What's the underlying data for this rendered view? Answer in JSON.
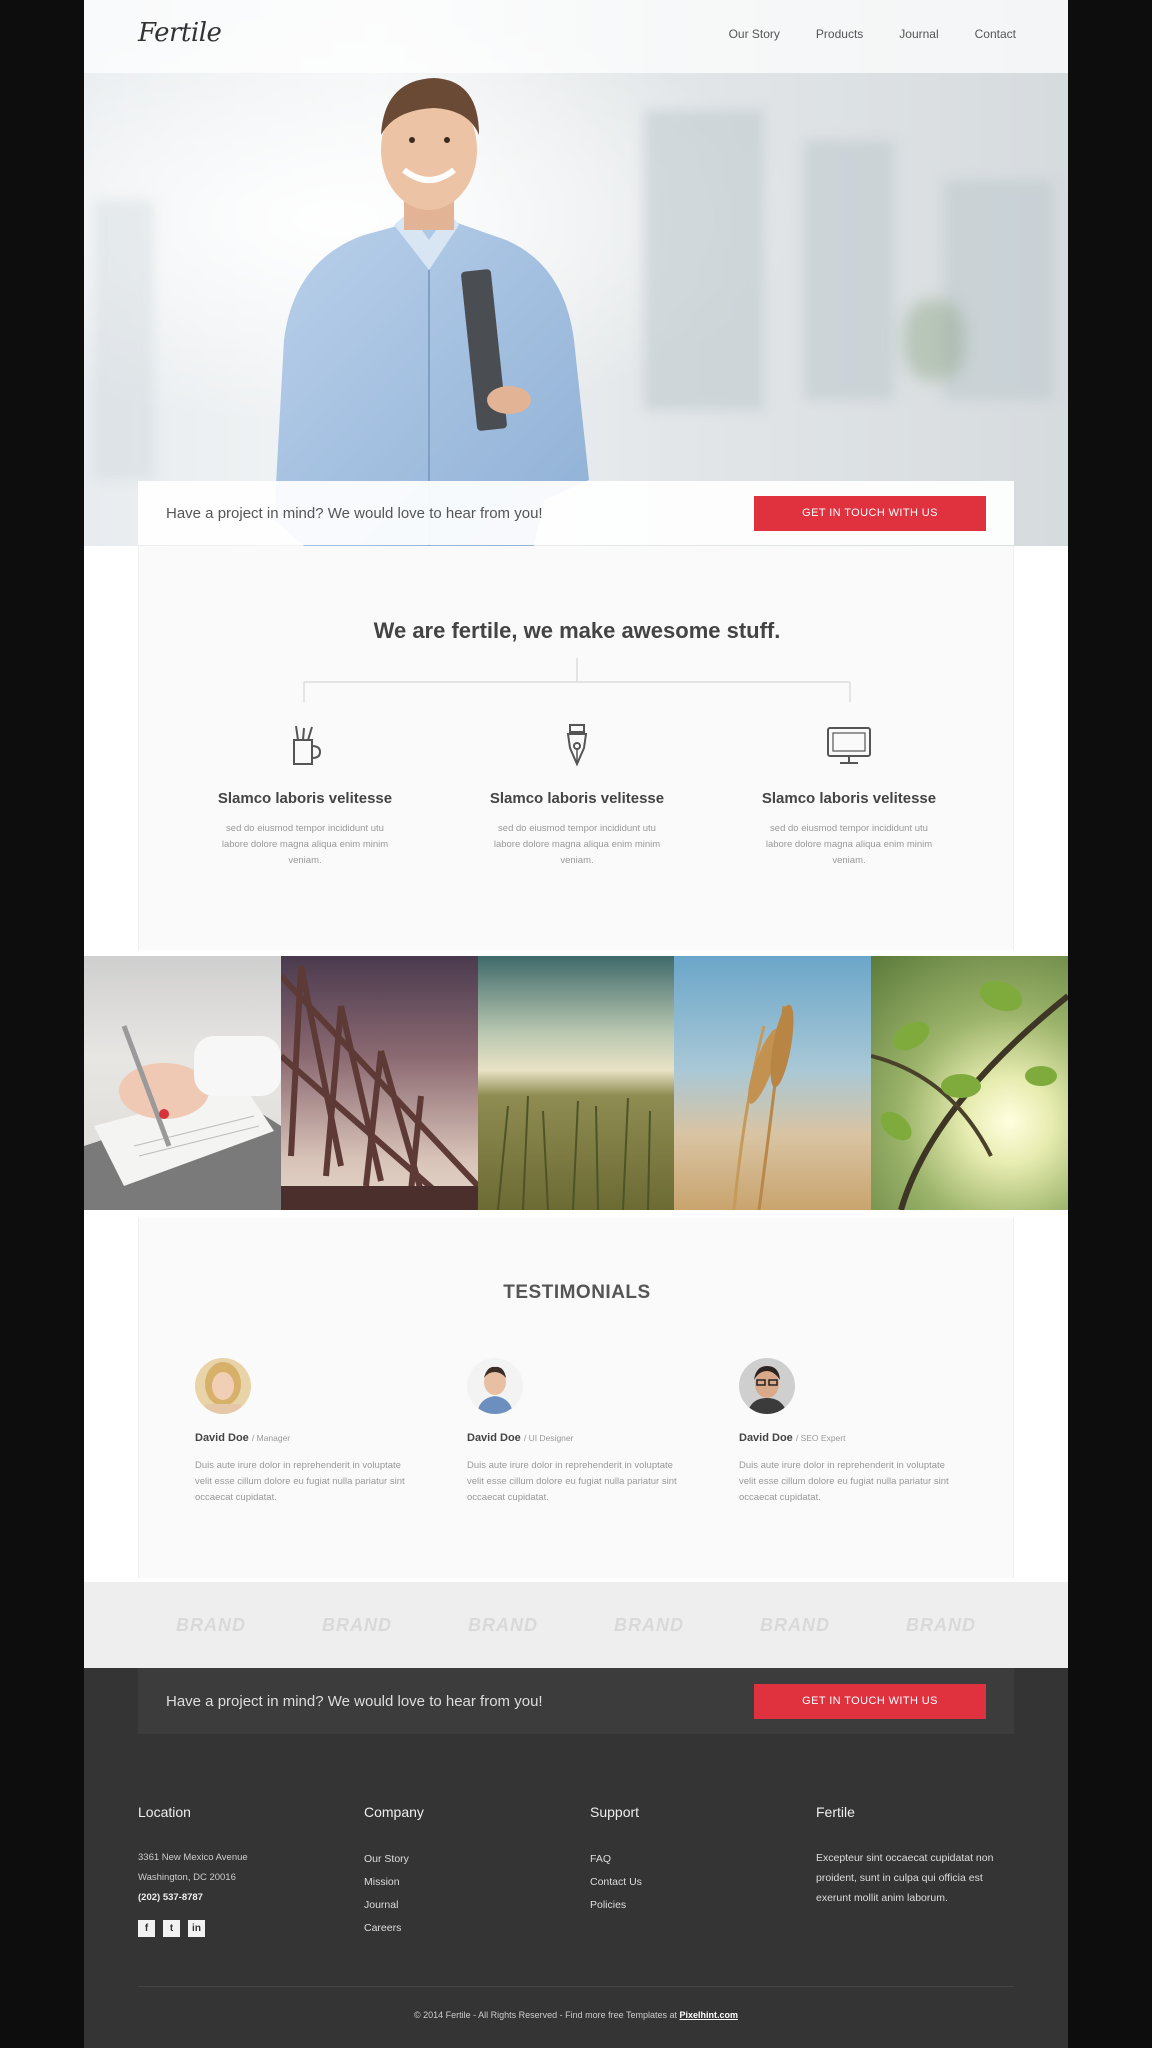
{
  "header": {
    "logo": "Fertile",
    "nav": [
      "Our Story",
      "Products",
      "Journal",
      "Contact"
    ]
  },
  "hero": {
    "cta_text": "Have a project in mind? We would love to hear from you!",
    "cta_button": "GET IN TOUCH WITH US"
  },
  "intro": {
    "title": "We are fertile, we make awesome stuff.",
    "features": [
      {
        "icon": "pencil-cup-icon",
        "title": "Slamco laboris velitesse",
        "text": "sed do eiusmod tempor incididunt utu labore dolore magna aliqua enim minim veniam."
      },
      {
        "icon": "pen-nib-icon",
        "title": "Slamco laboris velitesse",
        "text": "sed do eiusmod tempor incididunt utu labore dolore magna aliqua enim minim veniam."
      },
      {
        "icon": "monitor-icon",
        "title": "Slamco laboris velitesse",
        "text": "sed do eiusmod tempor incididunt utu labore dolore magna aliqua enim minim veniam."
      }
    ]
  },
  "gallery": [
    "writing-photo",
    "bridge-photo",
    "field-photo",
    "wheat-photo",
    "leaves-photo"
  ],
  "testimonials": {
    "title": "TESTIMONIALS",
    "items": [
      {
        "name": "David Doe",
        "role": "/ Manager",
        "quote": "Duis aute irure dolor in reprehenderit in voluptate velit esse cillum dolore eu fugiat nulla pariatur sint occaecat cupidatat."
      },
      {
        "name": "David Doe",
        "role": "/ UI Designer",
        "quote": "Duis aute irure dolor in reprehenderit in voluptate velit esse cillum dolore eu fugiat nulla pariatur sint occaecat cupidatat."
      },
      {
        "name": "David Doe",
        "role": "/ SEO Expert",
        "quote": "Duis aute irure dolor in reprehenderit in voluptate velit esse cillum dolore eu fugiat nulla pariatur sint occaecat cupidatat."
      }
    ]
  },
  "brands": [
    "BRAND",
    "BRAND",
    "BRAND",
    "BRAND",
    "BRAND",
    "BRAND"
  ],
  "footer": {
    "cta_text": "Have a project in mind? We would love to hear from you!",
    "cta_button": "GET IN TOUCH WITH US",
    "location": {
      "title": "Location",
      "address1": "3361 New Mexico Avenue",
      "address2": "Washington, DC 20016",
      "phone": "(202) 537-8787",
      "socials": [
        "f",
        "t",
        "in"
      ]
    },
    "company": {
      "title": "Company",
      "links": [
        "Our Story",
        "Mission",
        "Journal",
        "Careers"
      ]
    },
    "support": {
      "title": "Support",
      "links": [
        "FAQ",
        "Contact Us",
        "Policies"
      ]
    },
    "about": {
      "title": "Fertile",
      "text": "Excepteur sint occaecat cupidatat non proident, sunt in culpa qui officia est exerunt mollit anim laborum."
    },
    "copyright": "© 2014 Fertile - All Rights Reserved - Find more free Templates at",
    "copyright_link": "Pixelhint.com"
  },
  "colors": {
    "accent": "#e0313f",
    "footer_bg": "#343434",
    "brand_bg": "#eeeeee"
  }
}
